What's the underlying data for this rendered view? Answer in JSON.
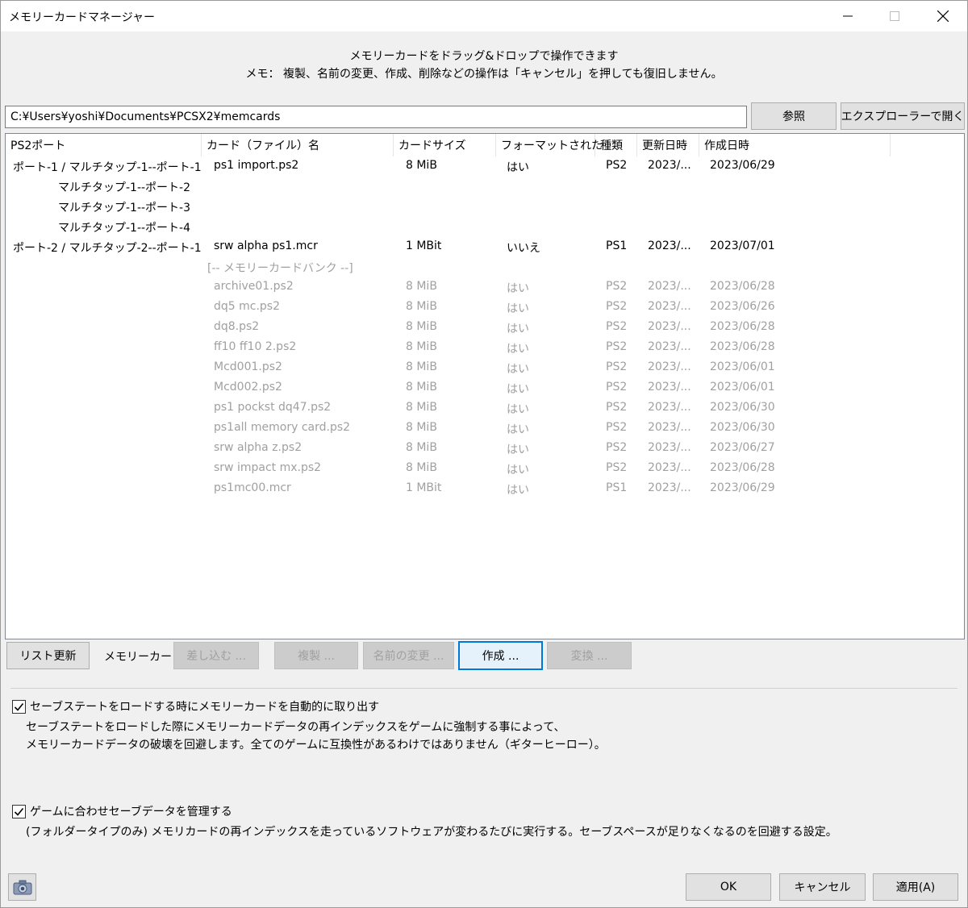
{
  "window": {
    "title": "メモリーカードマネージャー"
  },
  "notice": {
    "line1": "メモリーカードをドラッグ&ドロップで操作できます",
    "line2": "メモ： 複製、名前の変更、作成、削除などの操作は「キャンセル」を押しても復旧しません。"
  },
  "path": {
    "value": "C:¥Users¥yoshi¥Documents¥PCSX2¥memcards",
    "browse_label": "参照",
    "open_explorer_label": "エクスプローラーで開く"
  },
  "columns": [
    "PS2ポート",
    "カード（ファイル）名",
    "カードサイズ",
    "フォーマットされた",
    "種類",
    "更新日時",
    "作成日時"
  ],
  "ports": [
    {
      "port": "ポート-1 / マルチタップ-1--ポート-1",
      "name": "ps1 import.ps2",
      "size": "8 MiB",
      "formatted": "はい",
      "type": "PS2",
      "modified": "2023/...",
      "created": "2023/06/29"
    },
    {
      "port": "マルチタップ-1--ポート-2",
      "name": "",
      "size": "",
      "formatted": "",
      "type": "",
      "modified": "",
      "created": ""
    },
    {
      "port": "マルチタップ-1--ポート-3",
      "name": "",
      "size": "",
      "formatted": "",
      "type": "",
      "modified": "",
      "created": ""
    },
    {
      "port": "マルチタップ-1--ポート-4",
      "name": "",
      "size": "",
      "formatted": "",
      "type": "",
      "modified": "",
      "created": ""
    },
    {
      "port": "ポート-2 / マルチタップ-2--ポート-1",
      "name": "srw alpha ps1.mcr",
      "size": "1 MBit",
      "formatted": "いいえ",
      "type": "PS1",
      "modified": "2023/...",
      "created": "2023/07/01"
    }
  ],
  "bank_label": "[-- メモリーカードバンク --]",
  "bank": [
    {
      "name": "archive01.ps2",
      "size": "8 MiB",
      "formatted": "はい",
      "type": "PS2",
      "modified": "2023/...",
      "created": "2023/06/28"
    },
    {
      "name": "dq5 mc.ps2",
      "size": "8 MiB",
      "formatted": "はい",
      "type": "PS2",
      "modified": "2023/...",
      "created": "2023/06/26"
    },
    {
      "name": "dq8.ps2",
      "size": "8 MiB",
      "formatted": "はい",
      "type": "PS2",
      "modified": "2023/...",
      "created": "2023/06/28"
    },
    {
      "name": "ff10 ff10 2.ps2",
      "size": "8 MiB",
      "formatted": "はい",
      "type": "PS2",
      "modified": "2023/...",
      "created": "2023/06/28"
    },
    {
      "name": "Mcd001.ps2",
      "size": "8 MiB",
      "formatted": "はい",
      "type": "PS2",
      "modified": "2023/...",
      "created": "2023/06/01"
    },
    {
      "name": "Mcd002.ps2",
      "size": "8 MiB",
      "formatted": "はい",
      "type": "PS2",
      "modified": "2023/...",
      "created": "2023/06/01"
    },
    {
      "name": "ps1 pockst dq47.ps2",
      "size": "8 MiB",
      "formatted": "はい",
      "type": "PS2",
      "modified": "2023/...",
      "created": "2023/06/30"
    },
    {
      "name": "ps1all memory card.ps2",
      "size": "8 MiB",
      "formatted": "はい",
      "type": "PS2",
      "modified": "2023/...",
      "created": "2023/06/30"
    },
    {
      "name": "srw alpha z.ps2",
      "size": "8 MiB",
      "formatted": "はい",
      "type": "PS2",
      "modified": "2023/...",
      "created": "2023/06/27"
    },
    {
      "name": "srw impact mx.ps2",
      "size": "8 MiB",
      "formatted": "はい",
      "type": "PS2",
      "modified": "2023/...",
      "created": "2023/06/28"
    },
    {
      "name": "ps1mc00.mcr",
      "size": "1 MBit",
      "formatted": "はい",
      "type": "PS1",
      "modified": "2023/...",
      "created": "2023/06/29"
    }
  ],
  "toolbar": {
    "refresh_label": "リスト更新",
    "memcard_label": "メモリーカード:",
    "insert_label": "差し込む ...",
    "duplicate_label": "複製 ...",
    "rename_label": "名前の変更 ...",
    "create_label": "作成 ...",
    "convert_label": "変換 ..."
  },
  "options": {
    "auto_eject": {
      "checked": true,
      "label": "セーブステートをロードする時にメモリーカードを自動的に取り出す",
      "desc1": "セーブステートをロードした際にメモリーカードデータの再インデックスをゲームに強制する事によって、",
      "desc2": "メモリーカードデータの破壊を回避します。全てのゲームに互換性があるわけではありません（ギターヒーロー）。"
    },
    "manage_saves": {
      "checked": true,
      "label": "ゲームに合わせセーブデータを管理する",
      "desc": "(フォルダータイプのみ) メモリカードの再インデックスを走っているソフトウェアが変わるたびに実行する。セーブスペースが足りなくなるのを回避する設定。"
    }
  },
  "footer": {
    "ok_label": "OK",
    "cancel_label": "キャンセル",
    "apply_label": "適用(A)"
  }
}
